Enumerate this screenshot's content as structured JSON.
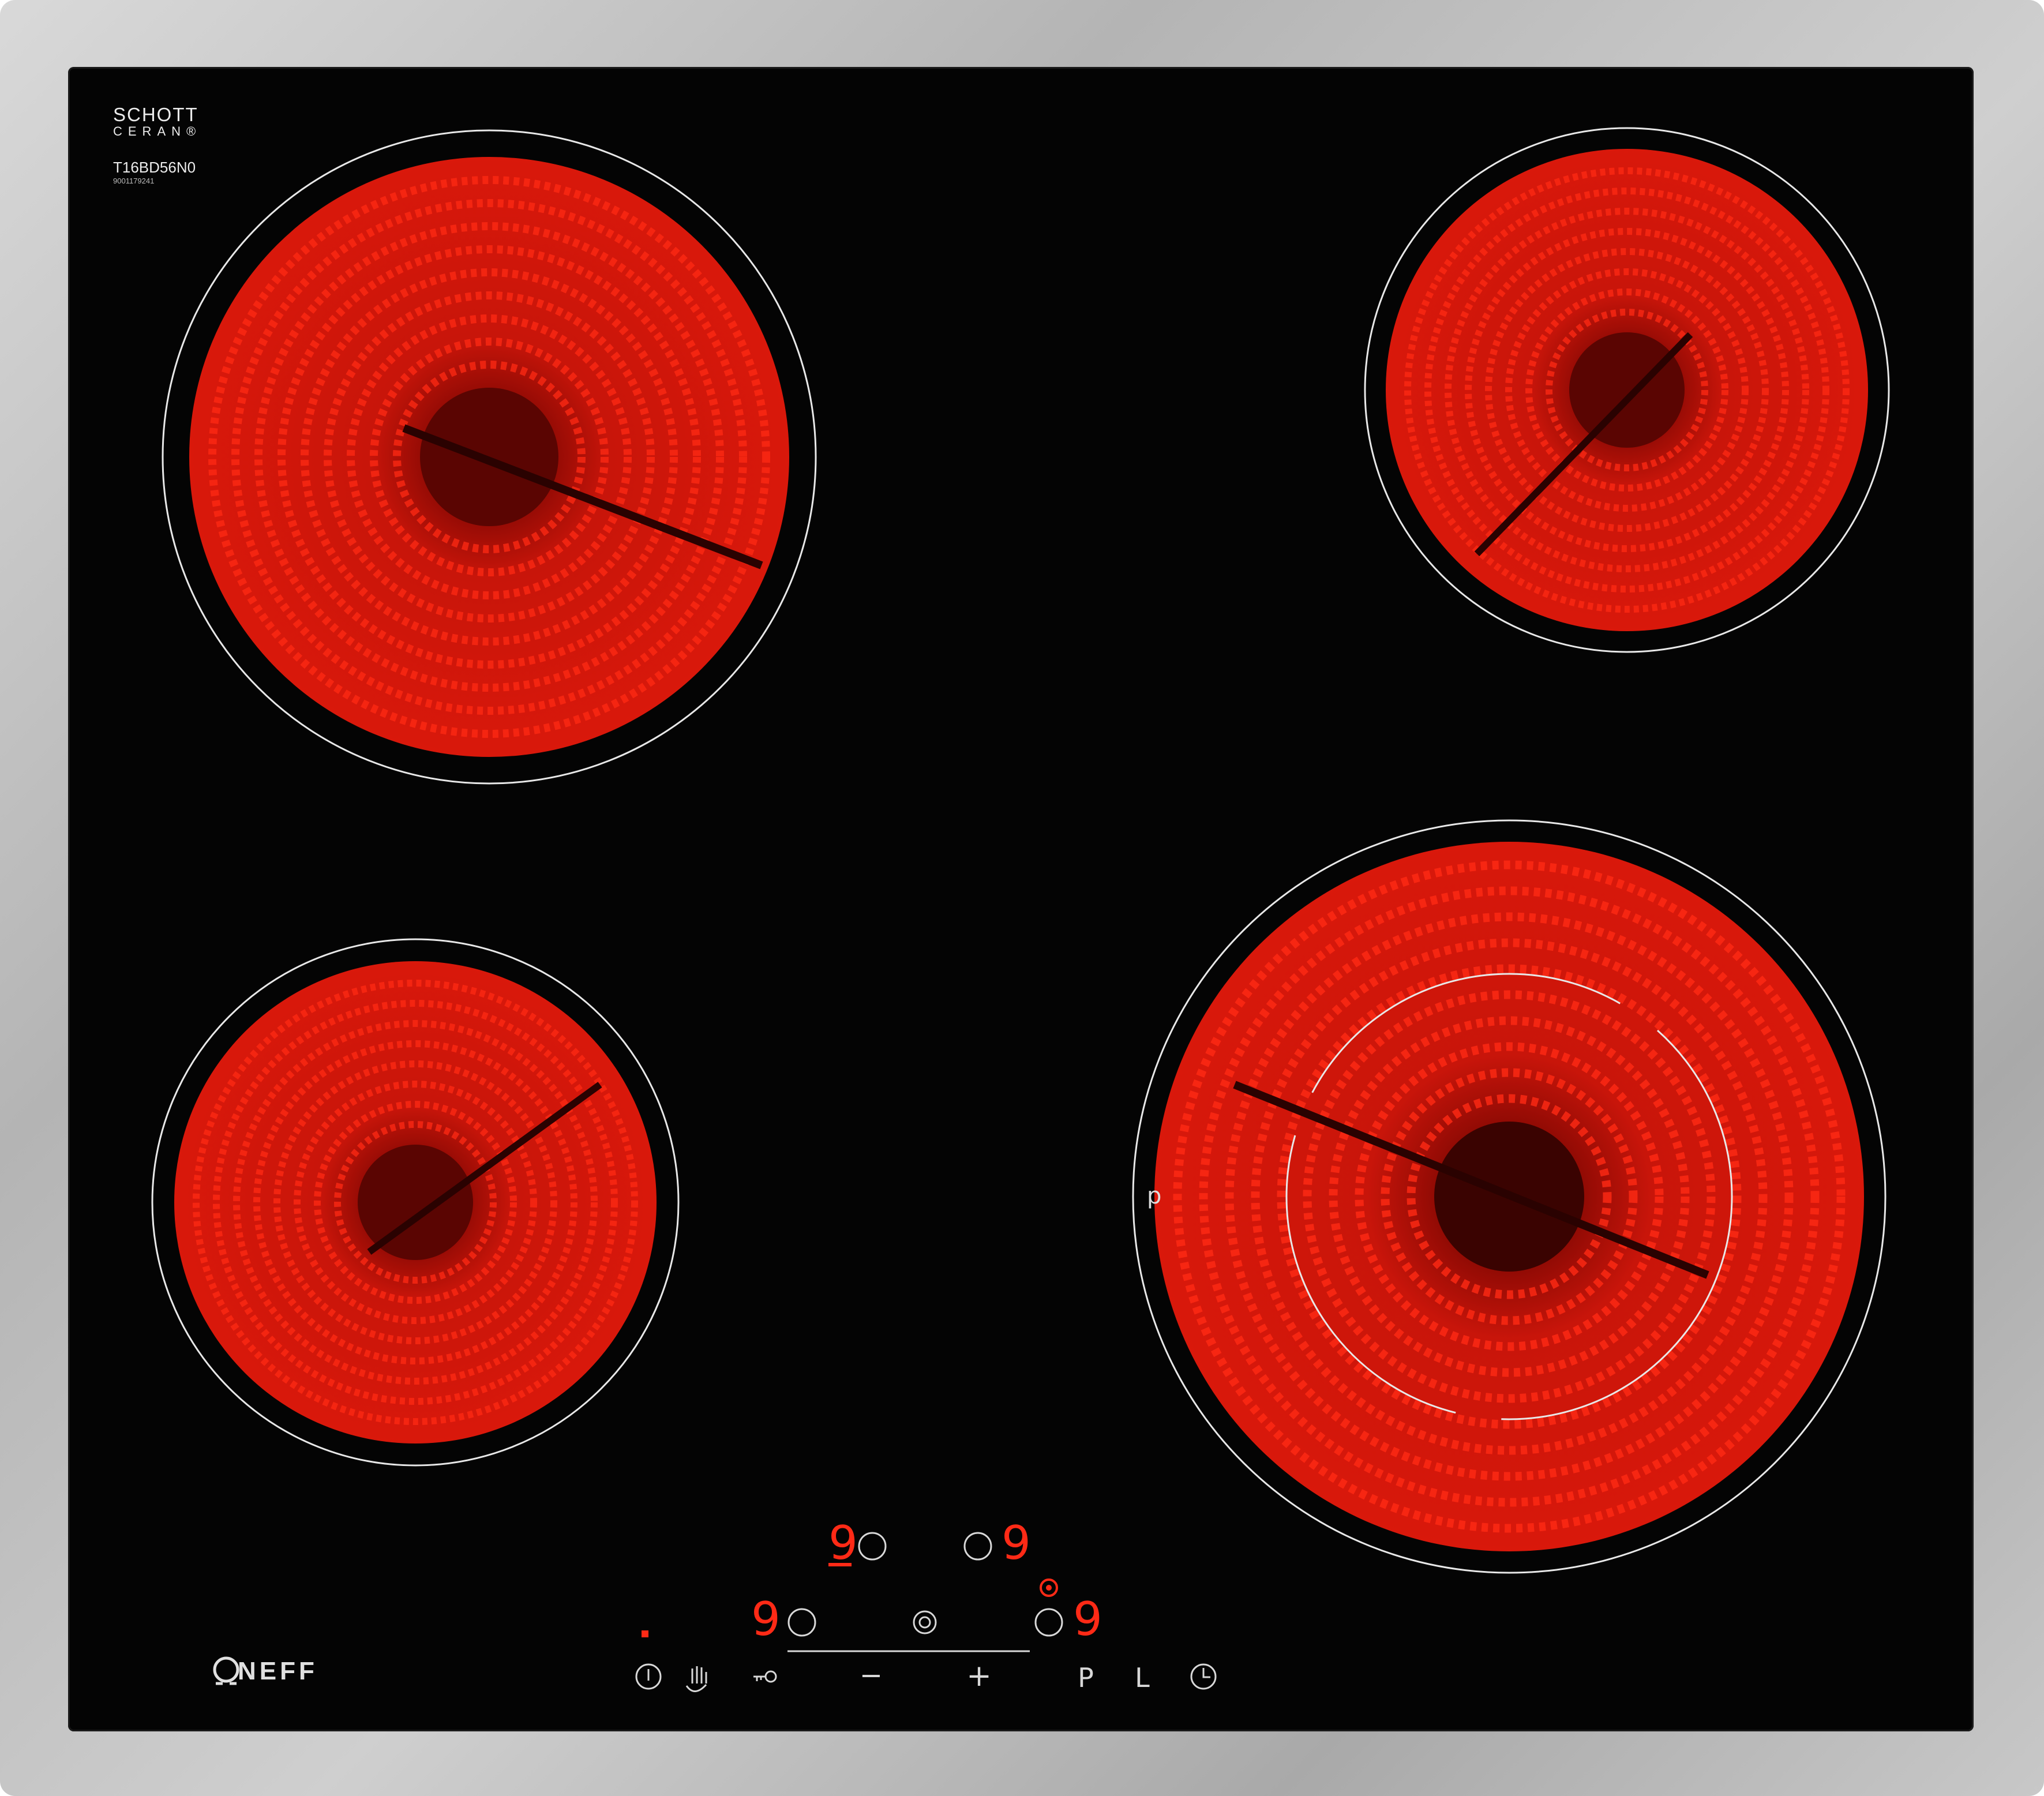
{
  "brand": {
    "glass_maker_line1": "SCHOTT",
    "glass_maker_line2": "CERAN®",
    "model_number": "T16BD56N0",
    "serial_number": "9001179241",
    "logo_text": "NEFF"
  },
  "colors": {
    "frame": "#c2c2c2",
    "glass": "#040404",
    "burner_glow": "#e41a0c",
    "display_digits": "#ff2a16",
    "controls": "#d8d8d8"
  },
  "cooktop": {
    "zones": [
      {
        "id": "front-left",
        "heat_level": "9"
      },
      {
        "id": "rear-left",
        "heat_level": "9"
      },
      {
        "id": "rear-right",
        "heat_level": "9"
      },
      {
        "id": "front-right-dual",
        "heat_level": "9",
        "dual_ring_active": true
      }
    ]
  },
  "controls": {
    "power_icon": "power-icon",
    "wipe_protection_icon": "hand-wipe-icon",
    "child_lock_icon": "key-icon",
    "minus_label": "−",
    "plus_label": "+",
    "pause_label": "P",
    "lock_label": "L",
    "timer_icon": "clock-icon",
    "zone_indicator_label": "p"
  }
}
